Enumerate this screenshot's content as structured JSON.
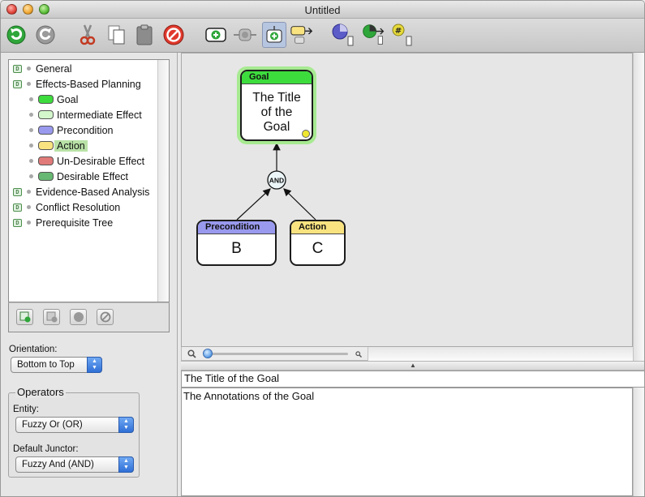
{
  "window": {
    "title": "Untitled"
  },
  "toolbar": {
    "icons": [
      "redo-icon",
      "undo-icon",
      "cut-icon",
      "copy-icon",
      "paste-icon",
      "delete-icon",
      "add-entity-icon",
      "insert-entity-icon",
      "add-child-icon",
      "add-sibling-icon",
      "attribute-icon",
      "connect-icon",
      "numbering-icon"
    ]
  },
  "tree": {
    "items": [
      {
        "label": "General",
        "kind": "folder"
      },
      {
        "label": "Effects-Based Planning",
        "kind": "folder"
      },
      {
        "label": "Goal",
        "kind": "type",
        "color": "#3ddc3d"
      },
      {
        "label": "Intermediate Effect",
        "kind": "type",
        "color": "#d3f6cb"
      },
      {
        "label": "Precondition",
        "kind": "type",
        "color": "#9999ee"
      },
      {
        "label": "Action",
        "kind": "type",
        "color": "#f9e380",
        "selected": true
      },
      {
        "label": "Un-Desirable Effect",
        "kind": "type",
        "color": "#e07b79"
      },
      {
        "label": "Desirable Effect",
        "kind": "type",
        "color": "#67b872"
      },
      {
        "label": "Evidence-Based Analysis",
        "kind": "folder"
      },
      {
        "label": "Conflict Resolution",
        "kind": "folder"
      },
      {
        "label": "Prerequisite Tree",
        "kind": "folder"
      }
    ],
    "toggle_glyph": "D"
  },
  "orientation": {
    "label": "Orientation:",
    "value": "Bottom to Top"
  },
  "operators": {
    "title": "Operators",
    "entity_label": "Entity:",
    "entity_value": "Fuzzy Or (OR)",
    "junctor_label": "Default Junctor:",
    "junctor_value": "Fuzzy And (AND)"
  },
  "diagram": {
    "goal": {
      "type": "Goal",
      "text": [
        "The Title",
        "of the",
        "Goal"
      ],
      "head_color": "#3ddc3d"
    },
    "junctor": "AND",
    "precondition": {
      "type": "Precondition",
      "text": "B",
      "head_color": "#9999ee"
    },
    "action": {
      "type": "Action",
      "text": "C",
      "head_color": "#f9e380"
    }
  },
  "editor": {
    "title": "The Title of the Goal",
    "annotation": "The Annotations of the Goal"
  },
  "colors": {
    "selection": "#b9e2a7",
    "canvas": "#e6e6e6"
  }
}
